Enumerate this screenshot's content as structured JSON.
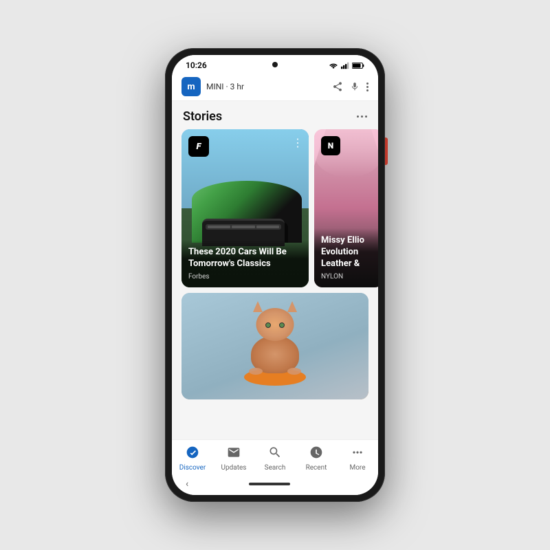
{
  "phone": {
    "status_bar": {
      "time": "10:26"
    },
    "notification": {
      "app_letter": "m",
      "app_name": "MINI",
      "time_ago": "3 hr"
    },
    "stories_section": {
      "title": "Stories",
      "card1": {
        "source_letter": "F",
        "headline": "These 2020 Cars Will Be Tomorrow's Classics",
        "source": "Forbes"
      },
      "card2": {
        "source_letter": "N",
        "headline": "Missy Ellio Evolution Leather &",
        "source": "NYLON"
      }
    },
    "bottom_nav": {
      "items": [
        {
          "label": "Discover",
          "active": true
        },
        {
          "label": "Updates",
          "active": false
        },
        {
          "label": "Search",
          "active": false
        },
        {
          "label": "Recent",
          "active": false
        },
        {
          "label": "More",
          "active": false
        }
      ]
    }
  }
}
